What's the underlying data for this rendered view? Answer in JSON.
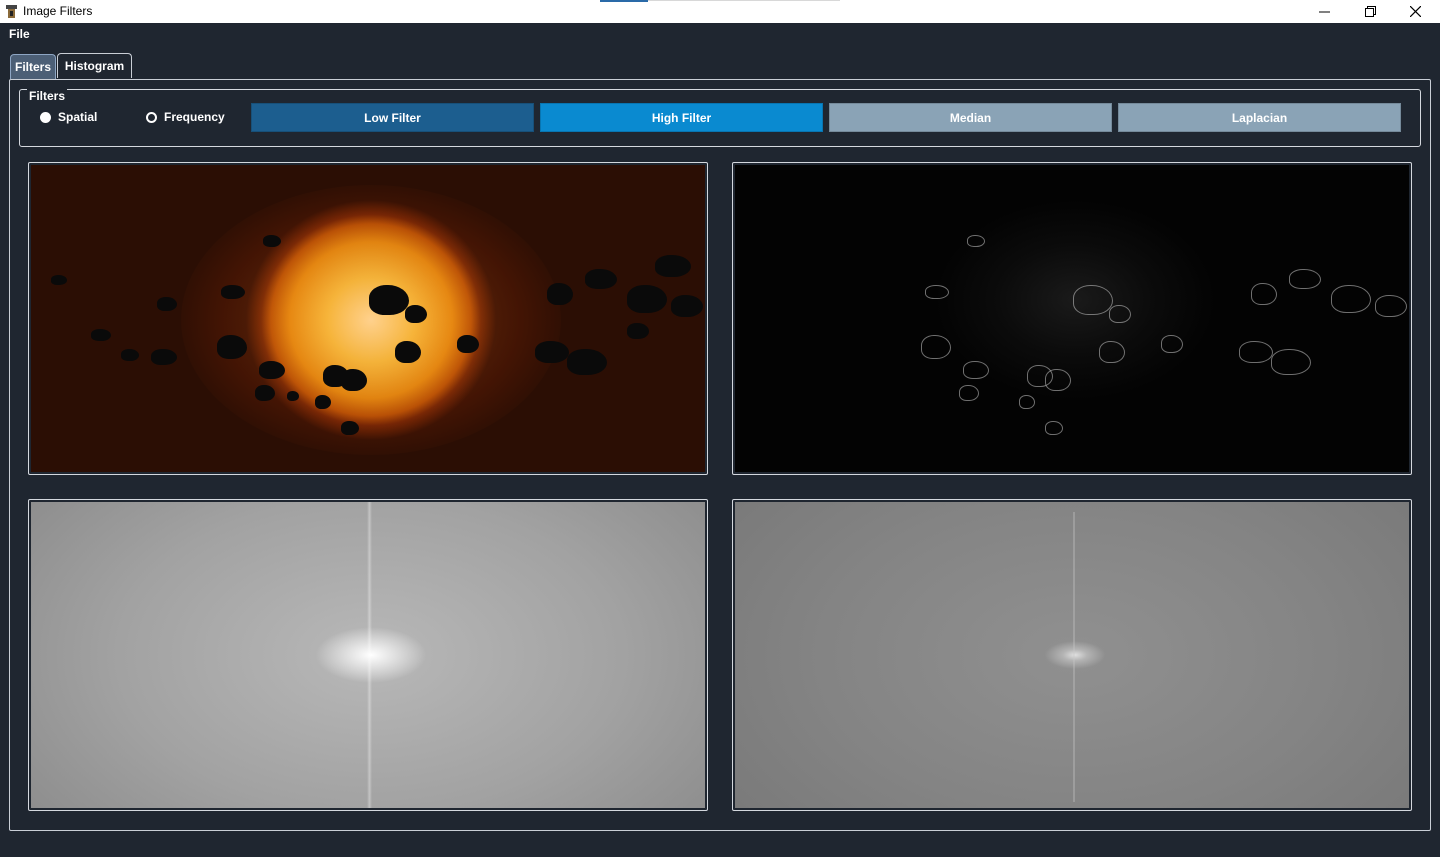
{
  "window": {
    "title": "Image Filters",
    "controls": {
      "minimize_icon": "minimize-icon",
      "maximize_icon": "restore-icon",
      "close_icon": "close-icon"
    }
  },
  "menu": {
    "file": "File"
  },
  "tabs": [
    {
      "label": "Filters",
      "active": true
    },
    {
      "label": "Histogram",
      "active": false
    }
  ],
  "filters_group": {
    "title": "Filters",
    "domain_options": [
      {
        "label": "Spatial",
        "selected": true
      },
      {
        "label": "Frequency",
        "selected": false
      }
    ],
    "buttons": [
      {
        "label": "Low Filter",
        "color": "#1c5e8f"
      },
      {
        "label": "High Filter",
        "color": "#0a8ad0"
      },
      {
        "label": "Median",
        "color": "#8aa3b6"
      },
      {
        "label": "Laplacian",
        "color": "#8aa3b6"
      }
    ]
  },
  "colors": {
    "background": "#1f2630",
    "accent": "#0a8ad0"
  }
}
